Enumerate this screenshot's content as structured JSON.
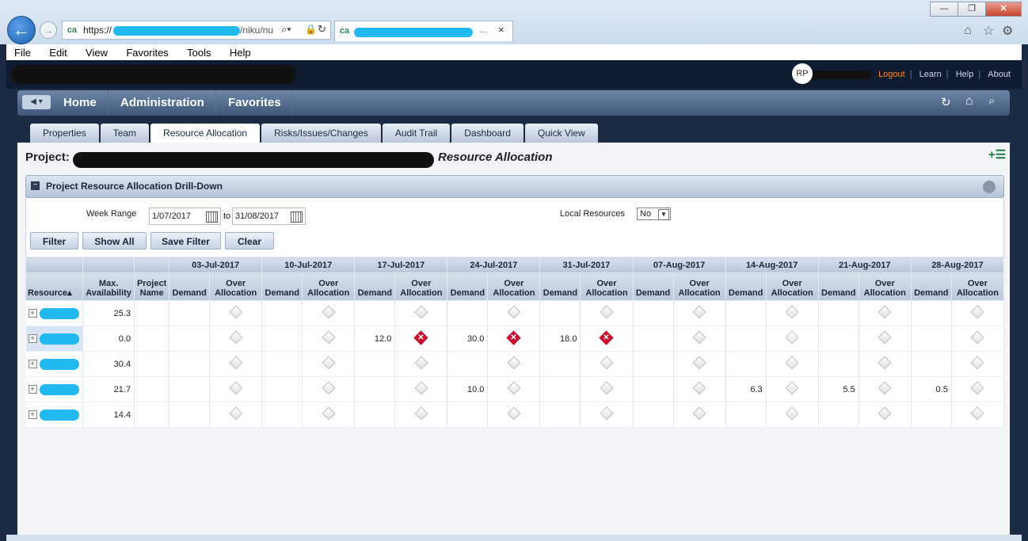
{
  "browser": {
    "url_prefix": "https://",
    "url_suffix": "/niku/nu",
    "tab_close": "×",
    "window_controls": [
      "—",
      "❐",
      "✕"
    ],
    "menu": [
      "File",
      "Edit",
      "View",
      "Favorites",
      "Tools",
      "Help"
    ]
  },
  "app": {
    "avatar": "RP",
    "top_links": [
      "Logout",
      "Learn",
      "Help",
      "About"
    ],
    "nav": [
      "Home",
      "Administration",
      "Favorites"
    ],
    "tabs": [
      {
        "label": "Properties",
        "active": false
      },
      {
        "label": "Team",
        "active": false
      },
      {
        "label": "Resource Allocation",
        "active": true
      },
      {
        "label": "Risks/Issues/Changes",
        "active": false
      },
      {
        "label": "Audit Trail",
        "active": false
      },
      {
        "label": "Dashboard",
        "active": false
      },
      {
        "label": "Quick View",
        "active": false
      }
    ]
  },
  "page": {
    "title_prefix": "Project:",
    "title_suffix": "Resource Allocation",
    "portlet_title": "Project Resource Allocation Drill-Down"
  },
  "filter": {
    "week_range_label": "Week Range",
    "from": "1/07/2017",
    "to_label": "to",
    "to": "31/08/2017",
    "local_resources_label": "Local Resources",
    "local_resources_value": "No",
    "buttons": [
      "Filter",
      "Show All",
      "Save Filter",
      "Clear"
    ]
  },
  "grid": {
    "col_resource": "Resource",
    "col_max_avail": "Max. Availability",
    "col_project": "Project Name",
    "col_demand": "Demand",
    "col_over": "Over Allocation",
    "weeks": [
      "03-Jul-2017",
      "10-Jul-2017",
      "17-Jul-2017",
      "24-Jul-2017",
      "31-Jul-2017",
      "07-Aug-2017",
      "14-Aug-2017",
      "21-Aug-2017",
      "28-Aug-2017"
    ],
    "rows": [
      {
        "avail": "25.3",
        "demand": [
          "",
          "",
          "",
          "",
          "",
          "",
          "",
          "",
          ""
        ],
        "over": [
          false,
          false,
          false,
          false,
          false,
          false,
          false,
          false,
          false
        ]
      },
      {
        "avail": "0.0",
        "demand": [
          "",
          "",
          "12.0",
          "30.0",
          "18.0",
          "",
          "",
          "",
          ""
        ],
        "over": [
          false,
          false,
          true,
          true,
          true,
          false,
          false,
          false,
          false
        ]
      },
      {
        "avail": "30.4",
        "demand": [
          "",
          "",
          "",
          "",
          "",
          "",
          "",
          "",
          ""
        ],
        "over": [
          false,
          false,
          false,
          false,
          false,
          false,
          false,
          false,
          false
        ]
      },
      {
        "avail": "21.7",
        "demand": [
          "",
          "",
          "",
          "10.0",
          "",
          "",
          "6.3",
          "5.5",
          "0.5"
        ],
        "over": [
          false,
          false,
          false,
          false,
          false,
          false,
          false,
          false,
          false
        ]
      },
      {
        "avail": "14.4",
        "demand": [
          "",
          "",
          "",
          "",
          "",
          "",
          "",
          "",
          ""
        ],
        "over": [
          false,
          false,
          false,
          false,
          false,
          false,
          false,
          false,
          false
        ]
      }
    ]
  },
  "colors": {
    "accent": "#f08a1e",
    "header": "#0f1b31",
    "alert": "#c8102e"
  }
}
